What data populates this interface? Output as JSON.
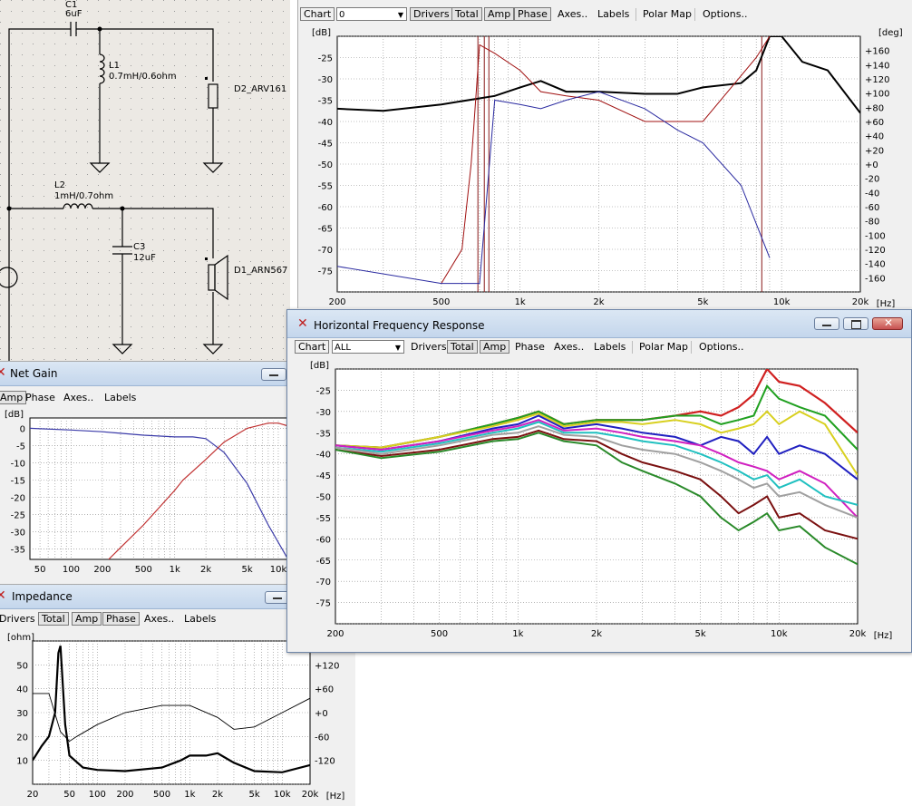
{
  "schematic": {
    "c1_name": "C1",
    "c1_value": "6uF",
    "l1_name": "L1",
    "l1_value": "0.7mH/0.6ohm",
    "d2_label": "D2_ARV161",
    "l2_name": "L2",
    "l2_value": "1mH/0.7ohm",
    "c3_name": "C3",
    "c3_value": "12uF",
    "d1_label": "D1_ARN567"
  },
  "top_window": {
    "toolbar": {
      "chart_label": "Chart",
      "chart_select": "0",
      "drivers": "Drivers",
      "total": "Total",
      "amp": "Amp",
      "phase": "Phase",
      "axes": "Axes..",
      "labels": "Labels",
      "polar_map": "Polar Map",
      "options": "Options.."
    },
    "chart": {
      "y_unit": "[dB]",
      "y2_unit": "[deg]",
      "x_unit": "[Hz]",
      "y_ticks": [
        "-25",
        "-30",
        "-35",
        "-40",
        "-45",
        "-50",
        "-55",
        "-60",
        "-65",
        "-70",
        "-75"
      ],
      "y2_ticks": [
        "+160",
        "+140",
        "+120",
        "+100",
        "+80",
        "+60",
        "+40",
        "+20",
        "+0",
        "-20",
        "-40",
        "-60",
        "-80",
        "-100",
        "-120",
        "-140",
        "-160"
      ],
      "x_ticks": [
        "200",
        "500",
        "1k",
        "2k",
        "5k",
        "10k",
        "20k"
      ]
    }
  },
  "net_gain": {
    "title": "Net Gain",
    "toolbar": {
      "amp": "Amp",
      "phase": "Phase",
      "axes": "Axes..",
      "labels": "Labels"
    },
    "y_unit": "[dB]",
    "y_ticks": [
      "0",
      "-5",
      "-10",
      "-15",
      "-20",
      "-25",
      "-30",
      "-35"
    ],
    "x_ticks": [
      "50",
      "100",
      "200",
      "500",
      "1k",
      "2k",
      "5k",
      "10k"
    ]
  },
  "impedance": {
    "title": "Impedance",
    "toolbar": {
      "drivers": "Drivers",
      "total": "Total",
      "amp": "Amp",
      "phase": "Phase",
      "axes": "Axes..",
      "labels": "Labels"
    },
    "y_unit": "[ohm]",
    "y_ticks": [
      "50",
      "40",
      "30",
      "20",
      "10"
    ],
    "y2_ticks": [
      "+120",
      "+60",
      "+0",
      "-60",
      "-120"
    ],
    "x_ticks": [
      "20",
      "50",
      "100",
      "200",
      "500",
      "1k",
      "2k",
      "5k",
      "10k",
      "20k"
    ],
    "x_unit": "[Hz]"
  },
  "hfr_window": {
    "title": "Horizontal Frequency Response",
    "toolbar": {
      "chart_label": "Chart",
      "chart_select": "ALL",
      "drivers": "Drivers",
      "total": "Total",
      "amp": "Amp",
      "phase": "Phase",
      "axes": "Axes..",
      "labels": "Labels",
      "polar_map": "Polar Map",
      "options": "Options.."
    },
    "y_unit": "[dB]",
    "x_unit": "[Hz]",
    "y_ticks": [
      "-25",
      "-30",
      "-35",
      "-40",
      "-45",
      "-50",
      "-55",
      "-60",
      "-65",
      "-70",
      "-75"
    ],
    "x_ticks": [
      "200",
      "500",
      "1k",
      "2k",
      "5k",
      "10k",
      "20k"
    ]
  },
  "chart_data": [
    {
      "type": "line",
      "name": "top-frequency-response",
      "xscale": "log",
      "xlim": [
        200,
        20000
      ],
      "ylim": [
        -80,
        -20
      ],
      "y2lim": [
        -180,
        180
      ],
      "series": [
        {
          "color": "#000000",
          "x": [
            200,
            300,
            500,
            800,
            1000,
            1200,
            1500,
            2000,
            3000,
            4000,
            5000,
            7000,
            8000,
            9000,
            10000,
            12000,
            15000,
            20000
          ],
          "y": [
            -37,
            -37.5,
            -36,
            -34,
            -32,
            -30.5,
            -33,
            -33,
            -33.5,
            -33.5,
            -32,
            -31,
            -28,
            -20,
            -20,
            -26,
            -28,
            -38
          ]
        },
        {
          "color": "#a01010",
          "x": [
            500,
            600,
            650,
            700,
            800,
            1000,
            1200,
            1500,
            2000,
            3000,
            5000,
            8000,
            9000
          ],
          "y": [
            -78,
            -70,
            -50,
            -22,
            -24,
            -28,
            -33,
            -34,
            -35,
            -40,
            -40,
            -25,
            -20
          ]
        },
        {
          "color": "#2a2aa0",
          "x": [
            200,
            500,
            700,
            800,
            1000,
            1200,
            1500,
            2000,
            3000,
            4000,
            5000,
            7000,
            9000
          ],
          "y": [
            -74,
            -78,
            -78,
            -35,
            -36,
            -37,
            -35,
            -33,
            -37,
            -42,
            -45,
            -55,
            -72
          ]
        }
      ]
    },
    {
      "type": "line",
      "name": "net-gain",
      "xscale": "log",
      "xlim": [
        40,
        13000
      ],
      "ylim": [
        -38,
        3
      ],
      "series": [
        {
          "color": "#3a3aa8",
          "x": [
            40,
            100,
            200,
            500,
            1000,
            1500,
            2000,
            3000,
            5000,
            8000,
            13000
          ],
          "y": [
            0,
            -0.5,
            -1,
            -2,
            -2.5,
            -2.5,
            -3,
            -7,
            -16,
            -28,
            -39
          ]
        },
        {
          "color": "#c03030",
          "x": [
            230,
            500,
            1000,
            1200,
            2000,
            3000,
            5000,
            8000,
            10000,
            13000
          ],
          "y": [
            -38,
            -28,
            -18,
            -15,
            -9,
            -4,
            0,
            1.5,
            1.5,
            0.5
          ]
        }
      ]
    },
    {
      "type": "line",
      "name": "impedance",
      "xscale": "log",
      "xlim": [
        20,
        20000
      ],
      "ylim": [
        0,
        60
      ],
      "y2lim": [
        -180,
        180
      ],
      "series": [
        {
          "color": "#000000",
          "x": [
            20,
            25,
            30,
            35,
            38,
            40,
            45,
            50,
            70,
            100,
            200,
            500,
            800,
            1000,
            1500,
            2000,
            3000,
            5000,
            10000,
            20000
          ],
          "y": [
            10,
            16,
            20,
            30,
            55,
            58,
            25,
            12,
            7,
            6,
            5.5,
            7,
            10,
            12,
            12,
            13,
            9,
            5.5,
            5,
            8
          ]
        },
        {
          "color": "#000000",
          "x": [
            20,
            30,
            40,
            50,
            60,
            100,
            200,
            500,
            1000,
            2000,
            3000,
            5000,
            10000,
            20000
          ],
          "y": [
            38,
            38,
            22,
            18,
            20,
            25,
            30,
            33,
            33,
            28,
            23,
            24,
            30,
            36
          ]
        }
      ]
    },
    {
      "type": "line",
      "name": "horizontal-frequency-response",
      "xscale": "log",
      "xlim": [
        200,
        20000
      ],
      "ylim": [
        -80,
        -20
      ],
      "x": [
        200,
        300,
        500,
        800,
        1000,
        1200,
        1500,
        2000,
        2500,
        3000,
        4000,
        5000,
        6000,
        7000,
        8000,
        9000,
        10000,
        12000,
        15000,
        20000
      ],
      "series": [
        {
          "color": "#d02020",
          "y": [
            -38,
            -38.5,
            -36,
            -33,
            -31.5,
            -30,
            -33,
            -32,
            -32,
            -32,
            -31,
            -30,
            -31,
            -29,
            -26,
            -20,
            -23,
            -24,
            -28,
            -35
          ]
        },
        {
          "color": "#20a020",
          "y": [
            -38,
            -38.5,
            -36,
            -33,
            -31.5,
            -30,
            -33,
            -32,
            -32,
            -32,
            -31,
            -31,
            -33,
            -32,
            -31,
            -24,
            -27,
            -29,
            -31,
            -39
          ]
        },
        {
          "color": "#d8d020",
          "y": [
            -38,
            -38.5,
            -36,
            -33.5,
            -32,
            -30.5,
            -33.5,
            -32.5,
            -32.5,
            -33,
            -32,
            -33,
            -35,
            -34,
            -33,
            -30,
            -33,
            -30,
            -33,
            -45
          ]
        },
        {
          "color": "#2020c0",
          "y": [
            -38,
            -39,
            -37,
            -34,
            -33,
            -31,
            -34,
            -33,
            -34,
            -35,
            -36,
            -38,
            -36,
            -37,
            -40,
            -36,
            -40,
            -38,
            -40,
            -46
          ]
        },
        {
          "color": "#d020c0",
          "y": [
            -38,
            -39,
            -37,
            -34.5,
            -33.5,
            -32,
            -34.5,
            -34,
            -35,
            -36,
            -37,
            -38,
            -40,
            -42,
            -43,
            -44,
            -46,
            -44,
            -47,
            -55
          ]
        },
        {
          "color": "#20c0c0",
          "y": [
            -38.5,
            -39.5,
            -37.5,
            -35,
            -34,
            -32.5,
            -35,
            -35,
            -36,
            -37,
            -38,
            -40,
            -42,
            -44,
            -46,
            -45,
            -48,
            -46,
            -50,
            -52
          ]
        },
        {
          "color": "#a0a0a0",
          "y": [
            -38.5,
            -40,
            -38,
            -35.5,
            -35,
            -33.5,
            -35.5,
            -36,
            -38,
            -39,
            -40,
            -42,
            -44,
            -46,
            -48,
            -47,
            -50,
            -49,
            -52,
            -55
          ]
        },
        {
          "color": "#7a1010",
          "y": [
            -39,
            -40.5,
            -39,
            -36.5,
            -36,
            -34.5,
            -36.5,
            -37,
            -40,
            -42,
            -44,
            -46,
            -50,
            -54,
            -52,
            -50,
            -55,
            -54,
            -58,
            -60
          ]
        },
        {
          "color": "#2a8a2a",
          "y": [
            -39,
            -41,
            -39.5,
            -37,
            -36.5,
            -35,
            -37,
            -38,
            -42,
            -44,
            -47,
            -50,
            -55,
            -58,
            -56,
            -54,
            -58,
            -57,
            -62,
            -66
          ]
        }
      ]
    }
  ]
}
